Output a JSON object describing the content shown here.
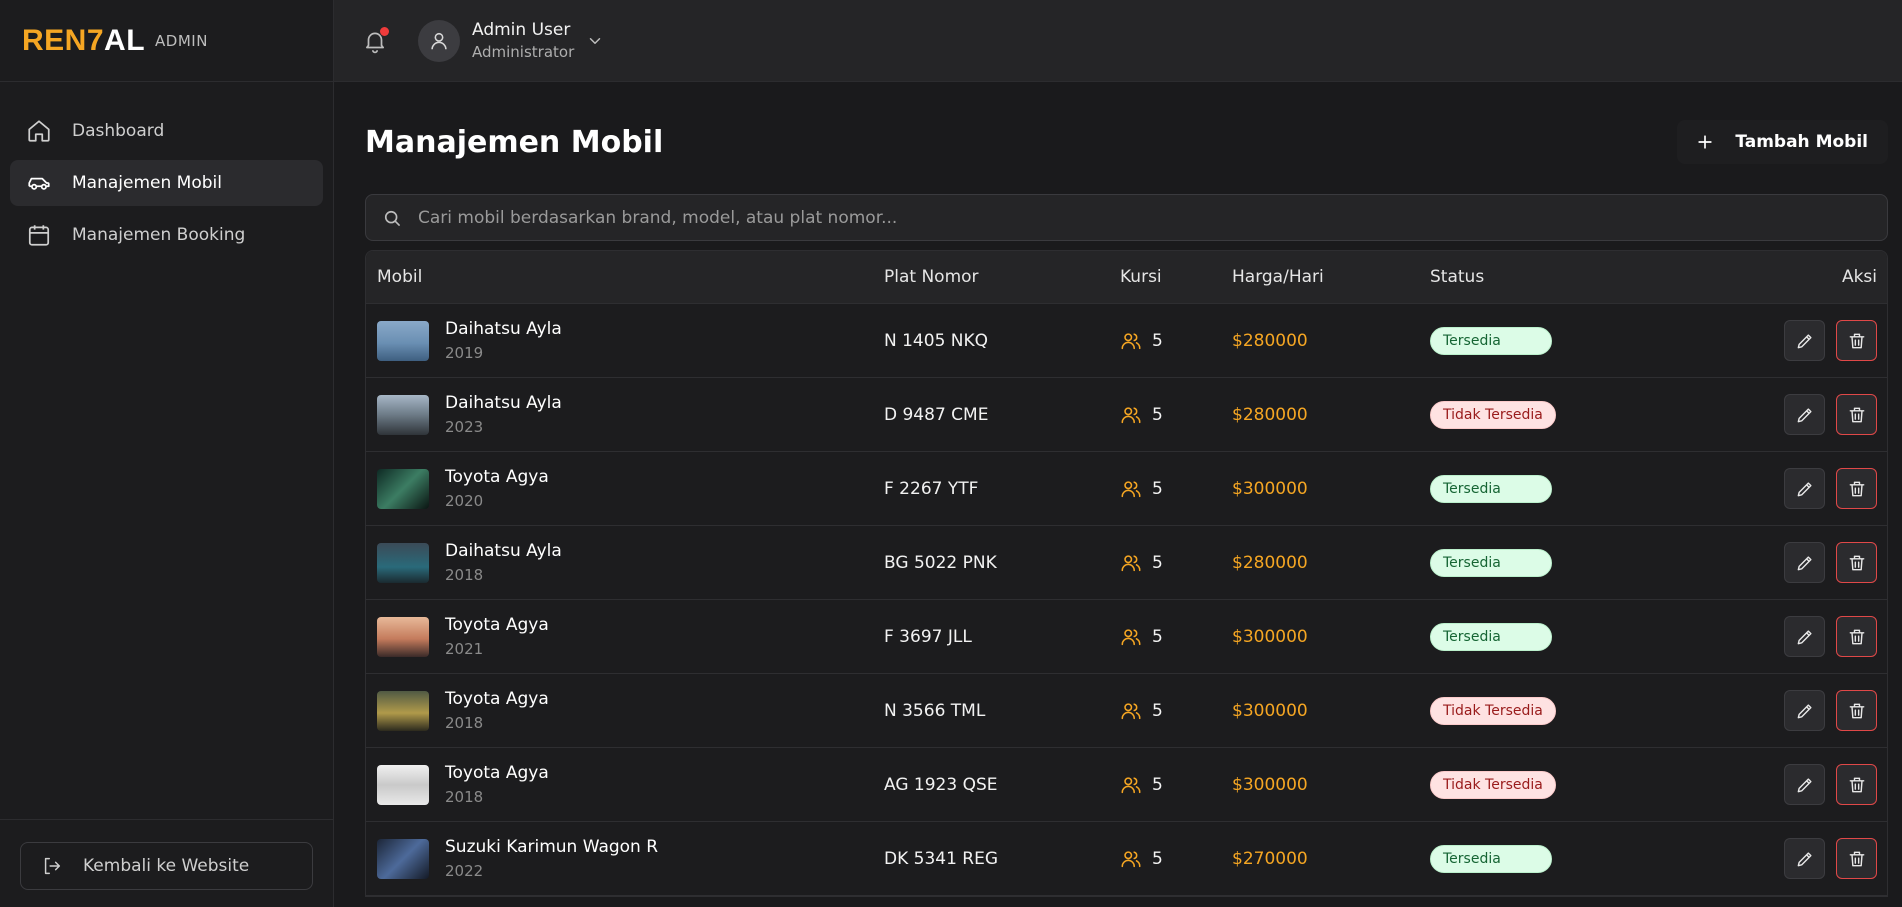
{
  "brand": {
    "logo_part1": "REN7",
    "logo_part2": "AL",
    "tag": "ADMIN"
  },
  "sidebar": {
    "items": [
      {
        "label": "Dashboard",
        "icon": "home-icon",
        "active": false
      },
      {
        "label": "Manajemen Mobil",
        "icon": "car-icon",
        "active": true
      },
      {
        "label": "Manajemen Booking",
        "icon": "calendar-icon",
        "active": false
      }
    ],
    "back_label": "Kembali ke Website"
  },
  "topbar": {
    "user_name": "Admin User",
    "user_role": "Administrator",
    "has_notification": true
  },
  "page": {
    "title": "Manajemen Mobil",
    "add_button": "Tambah Mobil",
    "search_placeholder": "Cari mobil berdasarkan brand, model, atau plat nomor..."
  },
  "table": {
    "headers": {
      "mobil": "Mobil",
      "plat": "Plat Nomor",
      "kursi": "Kursi",
      "harga": "Harga/Hari",
      "status": "Status",
      "aksi": "Aksi"
    },
    "rows": [
      {
        "name": "Daihatsu Ayla",
        "year": "2019",
        "plat": "N 1405 NKQ",
        "kursi": "5",
        "harga": "$280000",
        "status": "Tersedia",
        "available": true
      },
      {
        "name": "Daihatsu Ayla",
        "year": "2023",
        "plat": "D 9487 CME",
        "kursi": "5",
        "harga": "$280000",
        "status": "Tidak Tersedia",
        "available": false
      },
      {
        "name": "Toyota Agya",
        "year": "2020",
        "plat": "F 2267 YTF",
        "kursi": "5",
        "harga": "$300000",
        "status": "Tersedia",
        "available": true
      },
      {
        "name": "Daihatsu Ayla",
        "year": "2018",
        "plat": "BG 5022 PNK",
        "kursi": "5",
        "harga": "$280000",
        "status": "Tersedia",
        "available": true
      },
      {
        "name": "Toyota Agya",
        "year": "2021",
        "plat": "F 3697 JLL",
        "kursi": "5",
        "harga": "$300000",
        "status": "Tersedia",
        "available": true
      },
      {
        "name": "Toyota Agya",
        "year": "2018",
        "plat": "N 3566 TML",
        "kursi": "5",
        "harga": "$300000",
        "status": "Tidak Tersedia",
        "available": false
      },
      {
        "name": "Toyota Agya",
        "year": "2018",
        "plat": "AG 1923 QSE",
        "kursi": "5",
        "harga": "$300000",
        "status": "Tidak Tersedia",
        "available": false
      },
      {
        "name": "Suzuki Karimun Wagon R",
        "year": "2022",
        "plat": "DK 5341 REG",
        "kursi": "5",
        "harga": "$270000",
        "status": "Tersedia",
        "available": true
      }
    ]
  },
  "colors": {
    "accent": "#f5a623",
    "available_bg": "#dcfce7",
    "unavailable_bg": "#fee2e2",
    "danger": "#e04848"
  }
}
